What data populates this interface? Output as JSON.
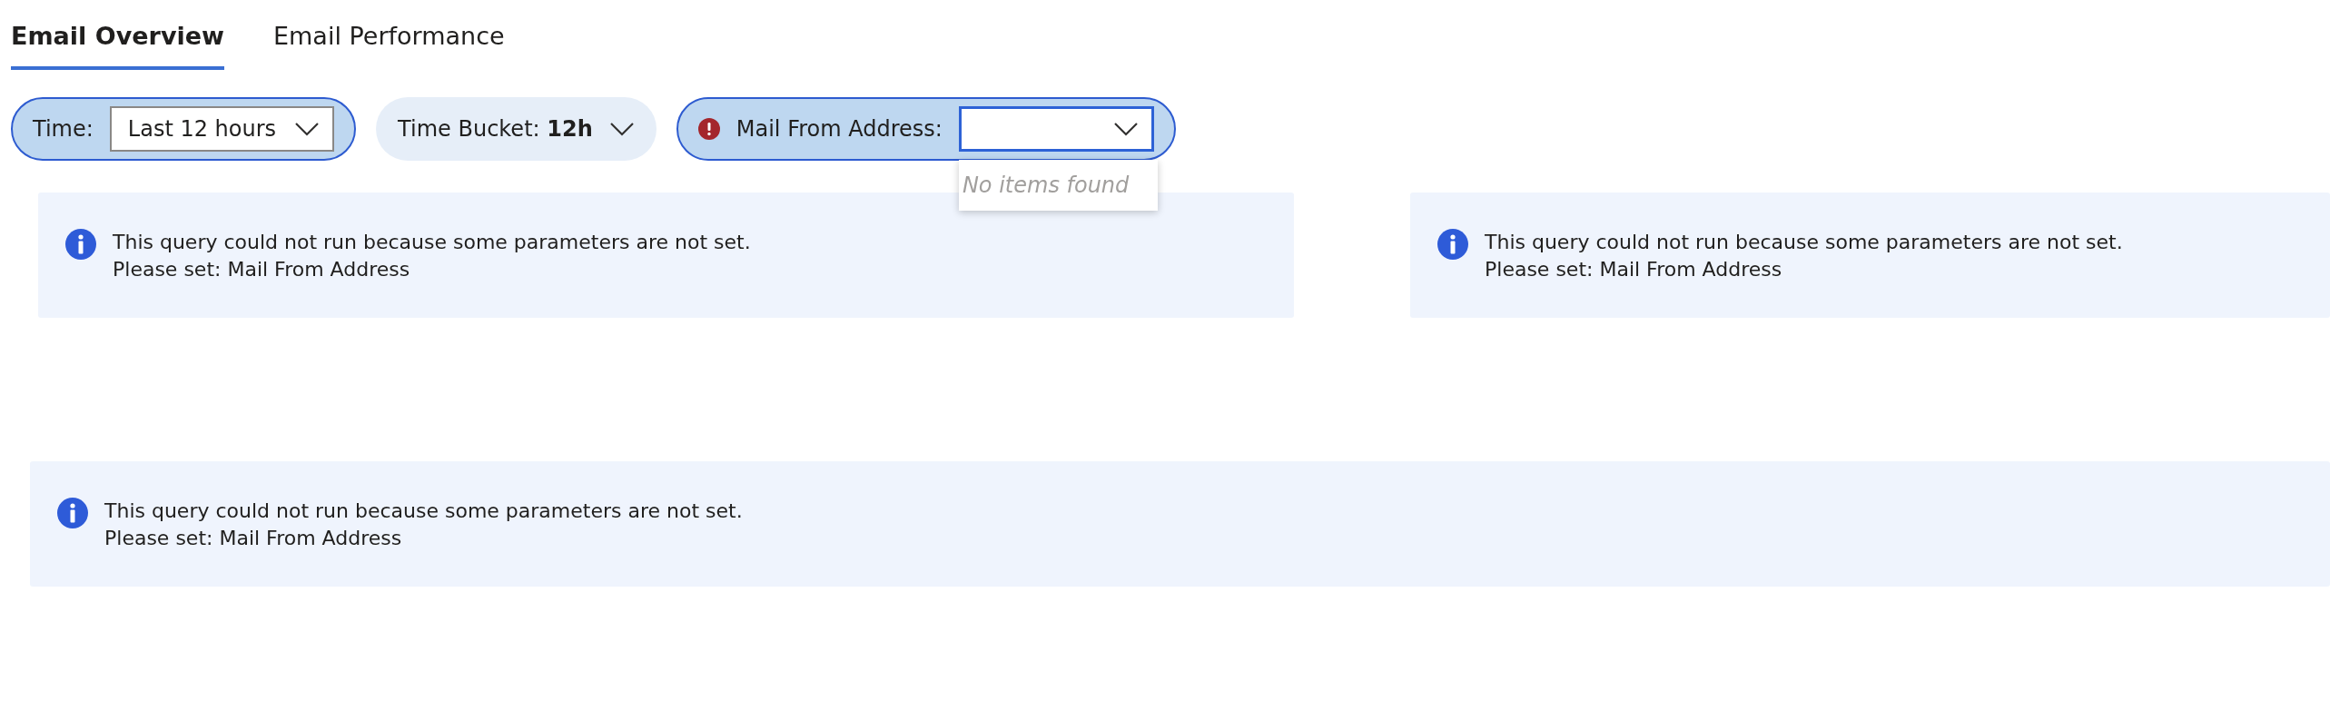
{
  "tabs": [
    {
      "label": "Email Overview",
      "selected": true
    },
    {
      "label": "Email Performance",
      "selected": false
    }
  ],
  "filters": [
    {
      "kind": "select",
      "label": "Time:",
      "value": "Last 12 hours",
      "highlighted": true,
      "error": false,
      "focused": false
    },
    {
      "kind": "inline",
      "label": "Time Bucket:",
      "value": "12h",
      "highlighted": false,
      "error": false
    },
    {
      "kind": "select",
      "label": "Mail From Address:",
      "highlighted": true,
      "error": true,
      "focused": true,
      "popup": {
        "empty_text": "No items found"
      }
    }
  ],
  "messages": [
    {
      "text": "This query could not run because some parameters are not set.",
      "detail": "Please set: Mail From Address"
    },
    {
      "text": "This query could not run because some parameters are not set.",
      "detail": "Please set: Mail From Address"
    },
    {
      "text": "This query could not run because some parameters are not set.",
      "detail": "Please set: Mail From Address"
    }
  ]
}
